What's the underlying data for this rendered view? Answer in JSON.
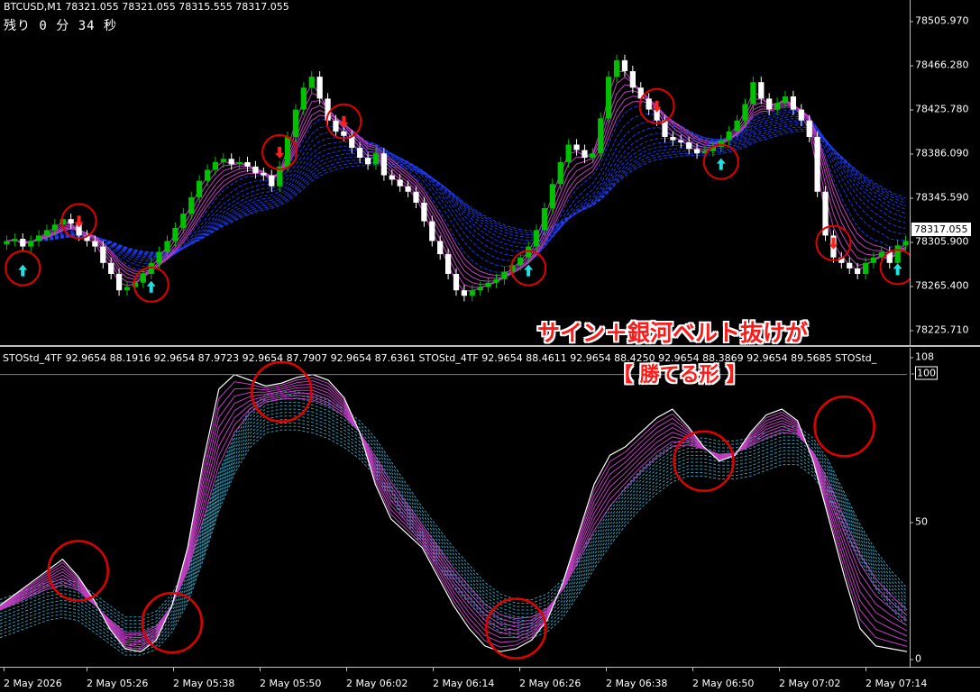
{
  "symbol_header": "BTCUSD,M1  78321.055 78321.055 78315.555 78317.055",
  "timer": "残り 0 分 34 秒",
  "indicator_header": "STOStd_4TF 92.9654 88.1916 92.9654 87.9723 92.9654 87.7907 92.9654 87.6361  STOStd_4TF 92.9654 88.4611 92.9654 88.4250 92.9654 88.3869 92.9654 89.5685  STOStd_",
  "annotation": {
    "line1": "サイン＋銀河ベルト抜けが",
    "line2": "【 勝てる形 】"
  },
  "current_price": "78317.055",
  "price_axis": [
    "78505.970",
    "78466.280",
    "78425.780",
    "78386.090",
    "78345.590",
    "78305.900",
    "78265.400",
    "78225.710"
  ],
  "osc_axis": [
    "108",
    "100",
    "50",
    "0"
  ],
  "time_axis": [
    "2 May 2026",
    "2 May 05:26",
    "2 May 05:38",
    "2 May 05:50",
    "2 May 06:02",
    "2 May 06:14",
    "2 May 06:26",
    "2 May 06:38",
    "2 May 06:50",
    "2 May 07:02",
    "2 May 07:14"
  ],
  "colors": {
    "bull": "#00c000",
    "bear": "#ffffff",
    "ribbon_fast": "#c040c0",
    "ribbon_slow": "#2040ff",
    "osc_slow": "#40c0e0",
    "circle": "#e00000",
    "arrow_up": "#20e0e0",
    "arrow_down": "#ff2020"
  },
  "chart_data": [
    {
      "type": "candlestick",
      "title": "BTCUSD,M1",
      "ylim": [
        78205,
        78520
      ],
      "close_series": [
        78300,
        78302,
        78295,
        78300,
        78305,
        78310,
        78315,
        78320,
        78316,
        78305,
        78300,
        78295,
        78280,
        78270,
        78255,
        78258,
        78262,
        78270,
        78280,
        78290,
        78300,
        78312,
        78325,
        78340,
        78355,
        78365,
        78372,
        78375,
        78370,
        78372,
        78368,
        78362,
        78360,
        78350,
        78368,
        78395,
        78420,
        78440,
        78450,
        78430,
        78410,
        78400,
        78396,
        78385,
        78376,
        78370,
        78380,
        78360,
        78356,
        78350,
        78345,
        78335,
        78318,
        78300,
        78288,
        78270,
        78255,
        78250,
        78255,
        78258,
        78262,
        78265,
        78272,
        78278,
        78285,
        78295,
        78310,
        78330,
        78352,
        78372,
        78388,
        78383,
        78376,
        78380,
        78412,
        78450,
        78465,
        78455,
        78440,
        78430,
        78420,
        78410,
        78395,
        78392,
        78390,
        78384,
        78380,
        78382,
        78386,
        78392,
        78400,
        78410,
        78425,
        78445,
        78430,
        78420,
        78426,
        78432,
        78420,
        78410,
        78395,
        78345,
        78305,
        78285,
        78280,
        78275,
        78270,
        78280,
        78285,
        78290,
        78280,
        78296,
        78300
      ],
      "signals": [
        {
          "index": 2,
          "dir": "up"
        },
        {
          "index": 9,
          "dir": "down"
        },
        {
          "index": 18,
          "dir": "up"
        },
        {
          "index": 34,
          "dir": "down"
        },
        {
          "index": 42,
          "dir": "down"
        },
        {
          "index": 65,
          "dir": "up"
        },
        {
          "index": 81,
          "dir": "down"
        },
        {
          "index": 89,
          "dir": "up"
        },
        {
          "index": 103,
          "dir": "down"
        },
        {
          "index": 111,
          "dir": "up"
        }
      ]
    },
    {
      "type": "line",
      "title": "STOStd_4TF",
      "ylim": [
        0,
        108
      ],
      "series": [
        {
          "values": [
            20,
            24,
            28,
            32,
            36,
            30,
            22,
            12,
            5,
            4,
            8,
            20,
            40,
            70,
            95,
            100,
            98,
            96,
            97,
            99,
            100,
            98,
            92,
            80,
            62,
            50,
            45,
            40,
            30,
            20,
            12,
            6,
            4,
            5,
            8,
            15,
            28,
            45,
            62,
            72,
            75,
            80,
            85,
            88,
            82,
            75,
            70,
            72,
            80,
            86,
            88,
            84,
            70,
            50,
            30,
            12,
            6,
            5,
            4
          ]
        },
        {
          "values": [
            18,
            20,
            22,
            24,
            25,
            24,
            20,
            16,
            12,
            12,
            14,
            20,
            30,
            45,
            62,
            75,
            84,
            89,
            90,
            90,
            89,
            87,
            84,
            80,
            74,
            66,
            58,
            50,
            43,
            36,
            30,
            24,
            20,
            18,
            18,
            20,
            25,
            33,
            42,
            50,
            57,
            63,
            68,
            72,
            74,
            74,
            73,
            73,
            74,
            76,
            78,
            78,
            74,
            66,
            55,
            44,
            35,
            28,
            22
          ]
        }
      ],
      "annotations": [
        "sign + galaxy belt"
      ]
    }
  ]
}
